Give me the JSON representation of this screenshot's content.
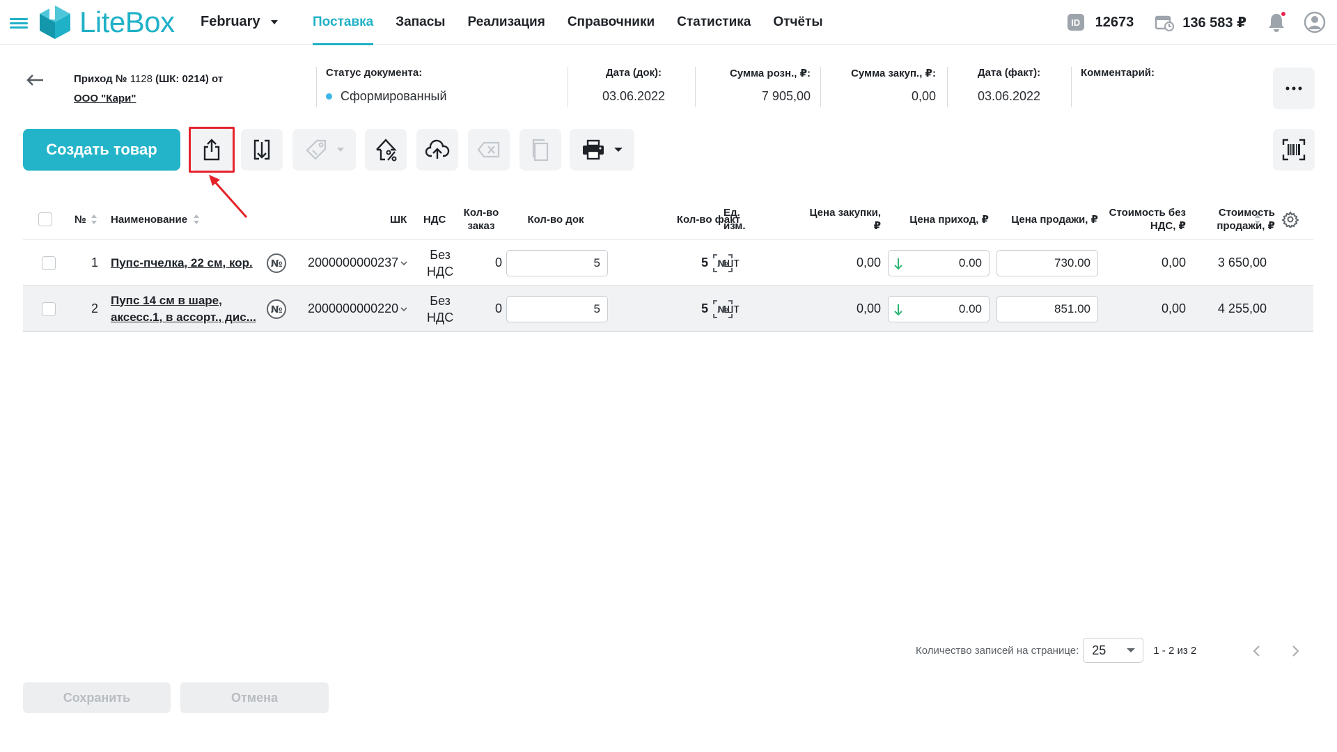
{
  "topbar": {
    "brand": "LiteBox",
    "store": "February",
    "nav": [
      "Поставка",
      "Запасы",
      "Реализация",
      "Справочники",
      "Статистика",
      "Отчёты"
    ],
    "active_nav": "Поставка",
    "id_icon_text": "ID",
    "account_id": "12673",
    "balance": "136 583 ₽",
    "accent_color": "#1fb1c7",
    "notification_dot_color": "#e5254d"
  },
  "document": {
    "title_prefix": "Приход №",
    "number": "1128",
    "barcode_part": "(ШК: 0214) от",
    "supplier": "ООО \"Кари\"",
    "status_label": "Статус документа:",
    "status_value": "Сформированный",
    "date_doc_label": "Дата (док):",
    "date_doc": "03.06.2022",
    "sum_retail_label": "Сумма розн., ₽:",
    "sum_retail": "7 905,00",
    "sum_purchase_label": "Сумма закуп., ₽:",
    "sum_purchase": "0,00",
    "date_fact_label": "Дата (факт):",
    "date_fact": "03.06.2022",
    "comment_label": "Комментарий:",
    "comment": ""
  },
  "toolbar": {
    "create_label": "Создать товар",
    "icons": [
      "export-icon",
      "import-icon",
      "price-tag-icon",
      "markup-percent-icon",
      "cloud-upload-icon",
      "delete-icon",
      "copy-icon",
      "print-icon",
      "barcode-scan-icon"
    ]
  },
  "table": {
    "headers": {
      "num": "№",
      "name": "Наименование",
      "barcode": "ШК",
      "nds": "НДС",
      "qty_order_1": "Кол-во",
      "qty_order_2": "заказ",
      "qty_doc": "Кол-во док",
      "qty_fact": "Кол-во факт",
      "unit_1": "Ед.",
      "unit_2": "изм.",
      "price_purchase_1": "Цена закупки,",
      "price_purchase_2": "₽",
      "price_in": "Цена приход, ₽",
      "price_sale": "Цена продажи, ₽",
      "cost_no_nds_1": "Стоимость без",
      "cost_no_nds_2": "НДС, ₽",
      "cost_sale_1": "Стоимость",
      "cost_sale_2": "продажи, ₽"
    },
    "rows": [
      {
        "num": "1",
        "name_1": "Пупс-пчелка, 22 см, кор.",
        "name_2": "",
        "barcode": "2000000000237",
        "nds_1": "Без",
        "nds_2": "НДС",
        "qty_order": "0",
        "qty_doc": "5",
        "qty_fact": "5",
        "unit": "шт",
        "price_purchase": "0,00",
        "price_in": "0.00",
        "price_sale": "730.00",
        "cost_no_nds": "0,00",
        "cost_sale": "3 650,00"
      },
      {
        "num": "2",
        "name_1": "Пупс 14 см в шаре,",
        "name_2": "аксесс.1, в ассорт., дис...",
        "barcode": "2000000000220",
        "nds_1": "Без",
        "nds_2": "НДС",
        "qty_order": "0",
        "qty_doc": "5",
        "qty_fact": "5",
        "unit": "шт",
        "price_purchase": "0,00",
        "price_in": "0.00",
        "price_sale": "851.00",
        "cost_no_nds": "0,00",
        "cost_sale": "4 255,00"
      }
    ]
  },
  "pagination": {
    "per_page_label": "Количество записей на странице:",
    "per_page": "25",
    "range": "1 - 2 из 2"
  },
  "footer": {
    "save_label": "Сохранить",
    "cancel_label": "Отмена"
  }
}
